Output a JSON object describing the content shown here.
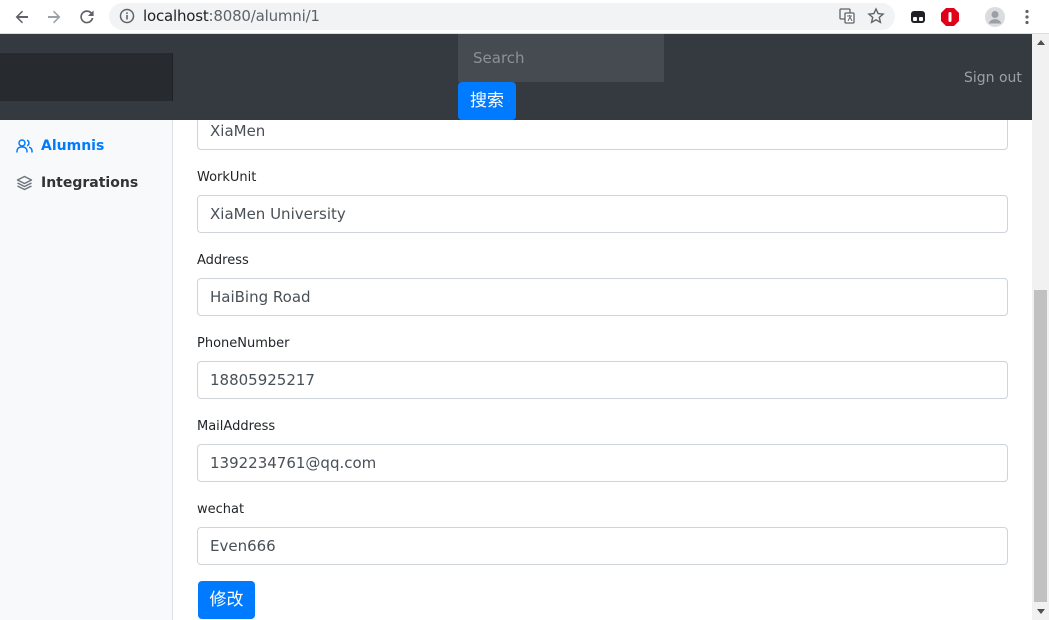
{
  "browser": {
    "url_host": "localhost",
    "url_rest": ":8080/alumni/1"
  },
  "navbar": {
    "search_placeholder": "Search",
    "search_button": "搜索",
    "sign_out": "Sign out"
  },
  "sidebar": {
    "items": [
      {
        "label": "Alumnis",
        "icon": "users-icon",
        "active": true
      },
      {
        "label": "Integrations",
        "icon": "layers-icon",
        "active": false
      }
    ]
  },
  "form": {
    "fields": [
      {
        "label": "",
        "value": "XiaMen"
      },
      {
        "label": "WorkUnit",
        "value": "XiaMen University"
      },
      {
        "label": "Address",
        "value": "HaiBing Road"
      },
      {
        "label": "PhoneNumber",
        "value": "18805925217"
      },
      {
        "label": "MailAddress",
        "value": "1392234761@qq.com"
      },
      {
        "label": "wechat",
        "value": "Even666"
      }
    ],
    "submit": "修改"
  },
  "colors": {
    "primary": "#007bff",
    "navbar_bg": "#343a40",
    "sidebar_bg": "#f8f9fa"
  }
}
